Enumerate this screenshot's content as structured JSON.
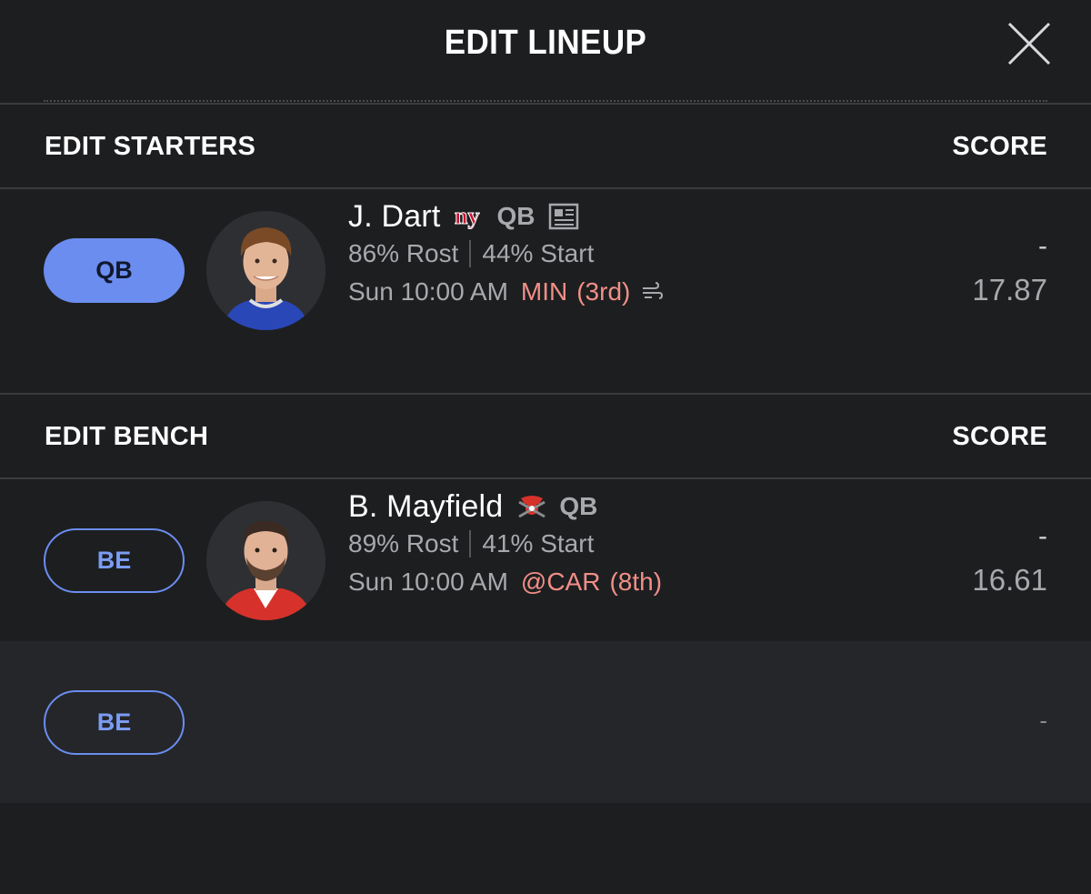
{
  "header": {
    "title": "EDIT LINEUP",
    "close_icon": "close-icon"
  },
  "starters": {
    "title": "EDIT STARTERS",
    "score_label": "SCORE",
    "rows": [
      {
        "slot": "QB",
        "name": "J. Dart",
        "team_logo": "ny",
        "position": "QB",
        "rost": "86% Rost",
        "start": "44% Start",
        "game_time": "Sun 10:00 AM",
        "opponent": "MIN",
        "opp_rank": "(3rd)",
        "actual_score": "-",
        "projected_score": "17.87"
      }
    ]
  },
  "bench": {
    "title": "EDIT BENCH",
    "score_label": "SCORE",
    "rows": [
      {
        "slot": "BE",
        "name": "B. Mayfield",
        "position": "QB",
        "rost": "89% Rost",
        "start": "41% Start",
        "game_time": "Sun 10:00 AM",
        "opponent": "@CAR",
        "opp_rank": "(8th)",
        "actual_score": "-",
        "projected_score": "16.61"
      },
      {
        "slot": "BE",
        "empty_score": "-"
      }
    ]
  },
  "colors": {
    "accent": "#6b8df0",
    "opponent": "#f08f86",
    "background": "#1d1e20"
  }
}
